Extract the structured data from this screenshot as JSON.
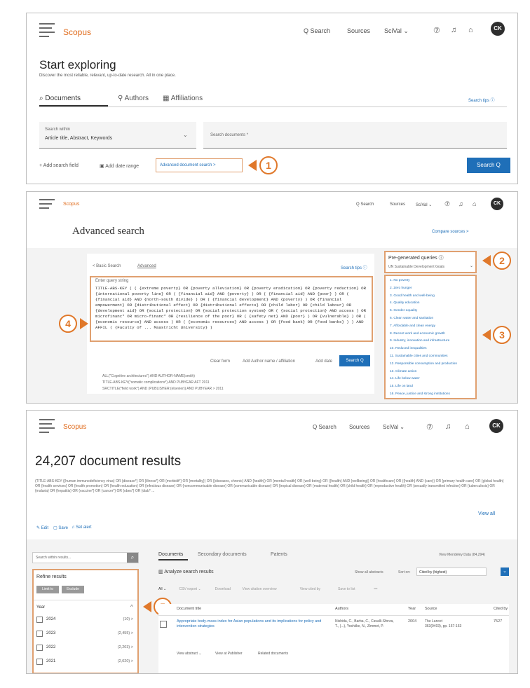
{
  "top_nav": {
    "brand": "Scopus",
    "search": "Q Search",
    "sources": "Sources",
    "user": "SciVal ⌄",
    "avatar": "CK"
  },
  "panel1": {
    "heading": "Start exploring",
    "subheading": "Discover the most reliable, relevant, up-to-date research. All in one place.",
    "tabs": [
      "Documents",
      "Authors",
      "Affiliations"
    ],
    "search_tips": "Search tips ⓘ",
    "search_within_label": "Search within",
    "search_within_value": "Article title, Abstract, Keywords",
    "search_placeholder": "Search documents *",
    "add_field": "+ Add search field",
    "add_date": "Add date range",
    "advanced_link": "Advanced document search >",
    "search_button": "Search Q",
    "callout": "1"
  },
  "panel2": {
    "heading": "Advanced search",
    "compare": "Compare sources >",
    "mode_basic": "< Basic Search",
    "mode_advanced": "Advanced",
    "search_tips": "Search tips ⓘ",
    "query_label": "Enter query string",
    "query_text": "TITLE-ABS-KEY ( ( {extreme poverty} OR {poverty alleviation} OR {poverty eradication} OR {poverty reduction} OR {international poverty line} OR ( {financial aid} AND {poverty} ) OR ( {financial aid} AND {poor} ) OR ( {financial aid} AND {north-south divide} ) OR ( {financial development} AND {poverty} ) OR {financial empowerment} OR {distributional effect} OR {distributional effects} OR {child labor} OR {child labour} OR {development aid} OR {social protection} OR {social protection system} OR ( {social protection} AND access ) OR microfinanc* OR micro-financ* OR {resilience of the poor} OR ( {safety net} AND {poor} ) OR {vulnerable} ) OR ( {economic resource} AND access ) OR ( {economic resources} AND access ) OR {food bank} OR {food banks} ) ) AND AFFIL ( {Faculty of ... Maastricht University} )",
    "clear_form": "Clear form",
    "add_author": "Add Author name / affiliation",
    "add_date": "Add date",
    "search_button": "Search Q",
    "examples": [
      "ALL(\"Cognitive architectures\") AND AUTHOR-NAME(smith)",
      "TITLE-ABS-KEY(*somatic complications*) AND PUBYEAR AFT 2011",
      "SRCTITLE(*field work*) AND (PUBLISHER:(elsevier)) AND PUBYEAR > 2011"
    ],
    "pregenerated_label": "Pre-generated queries ⓘ",
    "dropdown_value": "UN Sustainable Development Goals",
    "sdg_list": [
      "1. No poverty",
      "2. Zero hunger",
      "3. Good health and well-being",
      "4. Quality education",
      "5. Gender equality",
      "6. Clean water and sanitation",
      "7. Affordable and clean energy",
      "8. Decent work and economic growth",
      "9. Industry, innovation and infrastructure",
      "10. Reduced inequalities",
      "11. Sustainable cities and communities",
      "12. Responsible consumption and production",
      "13. Climate action",
      "14. Life below water",
      "15. Life on land",
      "16. Peace, justice and strong institutions"
    ],
    "callouts": [
      "2",
      "3",
      "4"
    ]
  },
  "panel3": {
    "results_count": "24,207 document results",
    "query_text": "(TITLE-ABS-KEY ({human immunodeficiency virus} OR {disease*} OR {illness*} OR {morbidit*} OR {mortality}) OR ({diseases, chronic} AND {health}) OR {mental health} OR {well-being} OR ({health} AND {wellbeing}) OR {healthcare} OR ({health} AND {care}) OR {primary health care} OR {global health} OR {health services} OR {health promotion} OR {health education} OR {infectious disease} OR {noncommunicable disease} OR {communicable disease} OR {tropical disease} OR {maternal health} OR {child health} OR {reproductive health} OR {sexually transmitted infection} OR {tuberculosis} OR {malaria} OR {hepatitis} OR {vaccine*} OR {cancer*} OR {obes*} OR {diab* ...",
    "view_all": "View all",
    "edit": "Edit",
    "save": "Save",
    "set_alert": "Set alert",
    "search_within_placeholder": "Search within results...",
    "refine": "Refine results",
    "limit_to": "Limit to",
    "exclude": "Exclude",
    "year_label": "Year",
    "years": [
      {
        "year": "2024",
        "count": "(10)"
      },
      {
        "year": "2023",
        "count": "(2,455)"
      },
      {
        "year": "2022",
        "count": "(2,203)"
      },
      {
        "year": "2021",
        "count": "(2,020)"
      }
    ],
    "tabs": [
      "Documents",
      "Secondary documents",
      "Patents"
    ],
    "view_mendeley": "View Mendeley Data (84,294)",
    "analyze": "Analyze search results",
    "show_abstract": "Show all abstracts",
    "sort_by": "Sort on:",
    "sort_value": "Cited by (highest)",
    "toolbar": [
      "All ⌄",
      "CSV export ⌄",
      "Download",
      "View citation overview",
      "View cited by",
      "Save to list",
      "•••"
    ],
    "columns": [
      "Document title",
      "Authors",
      "Year",
      "Source",
      "Cited by"
    ],
    "row": {
      "title": "Appropriate body-mass index for Asian populations and its implications for policy and intervention strategies",
      "authors": "Nishida, C., Barba, C., Cavalli-Sforza, T., (...), Yoshiike, N., Zimmet, P.",
      "year": "2004",
      "source": "The Lancet\n363(9403), pp. 157-163",
      "cited": "7527"
    },
    "row_links": [
      "View abstract ⌄",
      "View at Publisher",
      "Related documents"
    ],
    "callout": "5"
  }
}
